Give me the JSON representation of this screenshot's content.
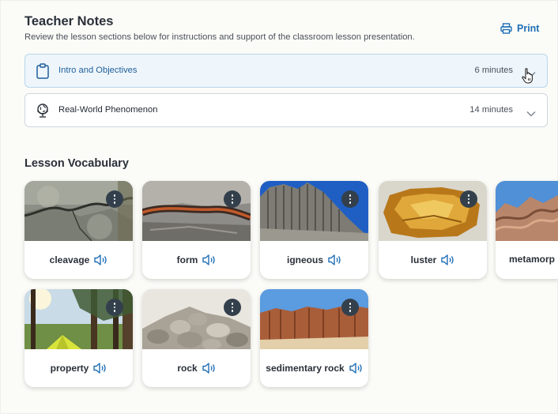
{
  "header": {
    "title": "Teacher Notes",
    "subtitle": "Review the lesson sections below for instructions and support of the classroom lesson presentation.",
    "print_label": "Print"
  },
  "sections": [
    {
      "label": "Intro and Objectives",
      "duration": "6 minutes",
      "icon": "clipboard-icon",
      "active": true
    },
    {
      "label": "Real-World Phenomenon",
      "duration": "14 minutes",
      "icon": "globe-icon",
      "active": false
    }
  ],
  "vocabulary": {
    "title": "Lesson Vocabulary",
    "words": [
      {
        "word": "cleavage",
        "image": "cracked gray rock"
      },
      {
        "word": "form",
        "image": "layered rock with orange vein"
      },
      {
        "word": "igneous",
        "image": "basalt columns under blue sky"
      },
      {
        "word": "luster",
        "image": "golden amber mineral"
      },
      {
        "word": "metamorp",
        "image": "folded metamorphic rock"
      },
      {
        "word": "property",
        "image": "forest campsite with yellow tent"
      },
      {
        "word": "rock",
        "image": "pile of rocks"
      },
      {
        "word": "sedimentary rock",
        "image": "red sedimentary cliffs"
      }
    ]
  },
  "colors": {
    "accent": "#1f6fb5",
    "active_bg": "#eef6fb",
    "menu_button": "#33404c"
  }
}
